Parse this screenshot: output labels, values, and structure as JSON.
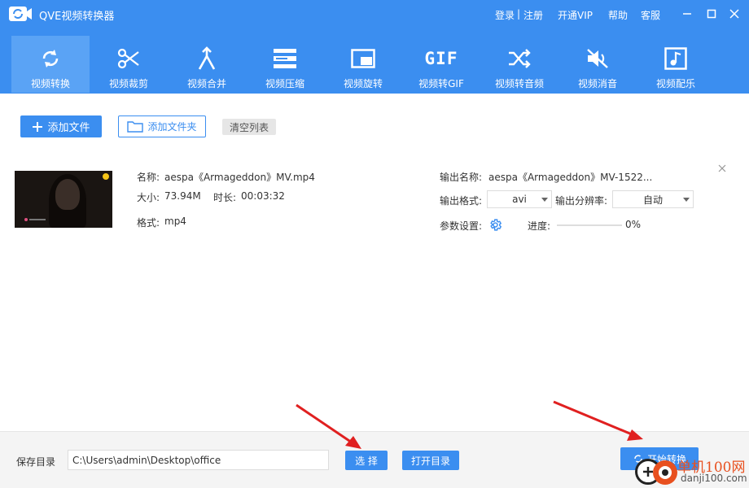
{
  "app": {
    "title": "QVE视频转换器",
    "links": {
      "login": "登录",
      "separator": "|",
      "register": "注册",
      "vip": "开通VIP",
      "help": "帮助",
      "service": "客服"
    },
    "accent_color": "#3b8ef0"
  },
  "toolbar": {
    "items": [
      {
        "label": "视频转换",
        "icon": "refresh-icon",
        "active": true
      },
      {
        "label": "视频裁剪",
        "icon": "scissors-icon",
        "active": false
      },
      {
        "label": "视频合并",
        "icon": "merge-icon",
        "active": false
      },
      {
        "label": "视频压缩",
        "icon": "compress-icon",
        "active": false
      },
      {
        "label": "视频旋转",
        "icon": "rotate-icon",
        "active": false
      },
      {
        "label": "视频转GIF",
        "icon": "gif-icon",
        "active": false
      },
      {
        "label": "视频转音频",
        "icon": "shuffle-icon",
        "active": false
      },
      {
        "label": "视频消音",
        "icon": "mute-icon",
        "active": false
      },
      {
        "label": "视频配乐",
        "icon": "music-icon",
        "active": false
      }
    ],
    "gif_glyph": "GIF"
  },
  "actions": {
    "add_file": "添加文件",
    "add_folder": "添加文件夹",
    "clear_list": "清空列表"
  },
  "file": {
    "name_label": "名称:",
    "name": "aespa《Armageddon》MV.mp4",
    "size_label": "大小:",
    "size": "73.94M",
    "duration_label": "时长:",
    "duration": "00:03:32",
    "format_label": "格式:",
    "format": "mp4",
    "output_name_label": "输出名称:",
    "output_name": "aespa《Armageddon》MV-1522...",
    "output_format_label": "输出格式:",
    "output_format": "avi",
    "output_resolution_label": "输出分辨率:",
    "output_resolution": "自动",
    "params_label": "参数设置:",
    "progress_label": "进度:",
    "progress_text": "0%",
    "progress": 0
  },
  "bottom": {
    "save_dir_label": "保存目录",
    "save_path": "C:\\Users\\admin\\Desktop\\office",
    "choose": "选 择",
    "open_dir": "打开目录",
    "start": "开始转换"
  },
  "watermark": {
    "text": "单机100网",
    "url": "danji100.com"
  }
}
